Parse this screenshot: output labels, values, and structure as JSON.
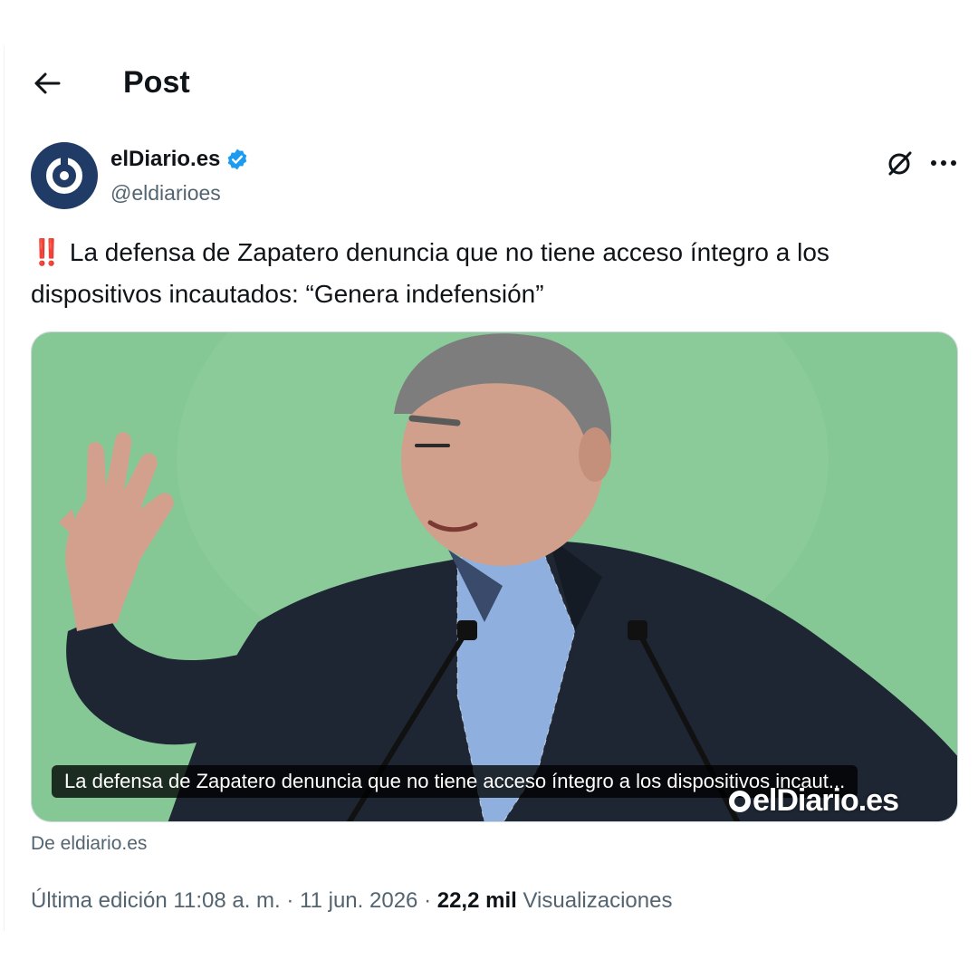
{
  "header": {
    "title": "Post",
    "back_icon": "arrow-left-icon"
  },
  "author": {
    "name": "elDiario.es",
    "handle": "@eldiarioes",
    "verified": true,
    "verified_color": "#1d9bf0",
    "avatar_color": "#1f3b66"
  },
  "actions": {
    "grok_icon": "grok-icon",
    "more_icon": "more-horizontal-icon"
  },
  "tweet": {
    "emoji": "‼️",
    "text": "La defensa de Zapatero denuncia que no tiene acceso íntegro a los dispositivos incautados: “Genera indefensión”"
  },
  "card": {
    "caption": "La defensa de Zapatero denuncia que no tiene acceso íntegro a los dispositivos incaut...",
    "watermark": "elDiario.es",
    "source": "De eldiario.es",
    "background_color": "#86c796"
  },
  "meta": {
    "edited_label": "Última edición",
    "time": "11:08 a. m.",
    "separator": "·",
    "date": "11 jun. 2026",
    "views_count": "22,2 mil",
    "views_label": "Visualizaciones"
  }
}
